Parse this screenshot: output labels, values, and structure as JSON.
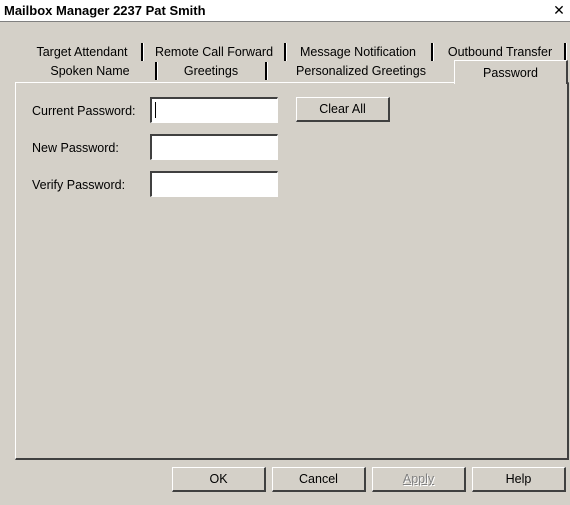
{
  "window": {
    "title": "Mailbox Manager 2237 Pat Smith",
    "close_glyph": "✕"
  },
  "tabs": {
    "row1": [
      "Target Attendant",
      "Remote Call Forward",
      "Message Notification",
      "Outbound Transfer"
    ],
    "row2": [
      "Spoken Name",
      "Greetings",
      "Personalized Greetings",
      "Password"
    ],
    "active": "Password"
  },
  "password_form": {
    "current_label": "Current Password:",
    "current_value": "",
    "new_label": "New Password:",
    "new_value": "",
    "verify_label": "Verify Password:",
    "verify_value": "",
    "clear_all_label": "Clear All"
  },
  "footer": {
    "ok_label": "OK",
    "cancel_label": "Cancel",
    "apply_label": "Apply",
    "apply_enabled": false,
    "help_label": "Help"
  },
  "colors": {
    "dialog_bg": "#d4d0c8",
    "titlebar_bg": "#ffffff"
  }
}
